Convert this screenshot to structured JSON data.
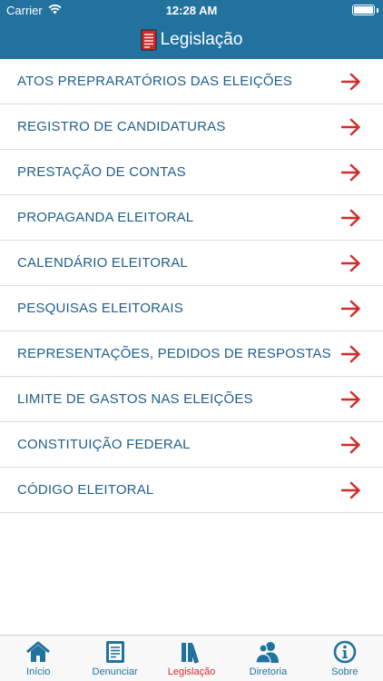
{
  "status_bar": {
    "carrier": "Carrier",
    "time": "12:28 AM"
  },
  "nav": {
    "title": "Legislação"
  },
  "items": [
    {
      "label": "ATOS PREPRARATÓRIOS DAS ELEIÇÕES"
    },
    {
      "label": "REGISTRO DE CANDIDATURAS"
    },
    {
      "label": "PRESTAÇÃO DE CONTAS"
    },
    {
      "label": "PROPAGANDA ELEITORAL"
    },
    {
      "label": "CALENDÁRIO ELEITORAL"
    },
    {
      "label": "PESQUISAS ELEITORAIS"
    },
    {
      "label": "REPRESENTAÇÕES, PEDIDOS DE RESPOSTAS"
    },
    {
      "label": "LIMITE DE GASTOS NAS ELEIÇÕES"
    },
    {
      "label": "CONSTITUIÇÃO FEDERAL"
    },
    {
      "label": "CÓDIGO ELEITORAL"
    }
  ],
  "tabs": [
    {
      "label": "Início",
      "icon": "home-icon"
    },
    {
      "label": "Denunciar",
      "icon": "report-icon"
    },
    {
      "label": "Legislação",
      "icon": "books-icon",
      "active": true
    },
    {
      "label": "Diretoria",
      "icon": "people-icon"
    },
    {
      "label": "Sobre",
      "icon": "info-icon"
    }
  ],
  "colors": {
    "header": "#21729f",
    "arrow": "#d42a2a",
    "label": "#1f5f89",
    "active_tab": "#d42a2a"
  }
}
